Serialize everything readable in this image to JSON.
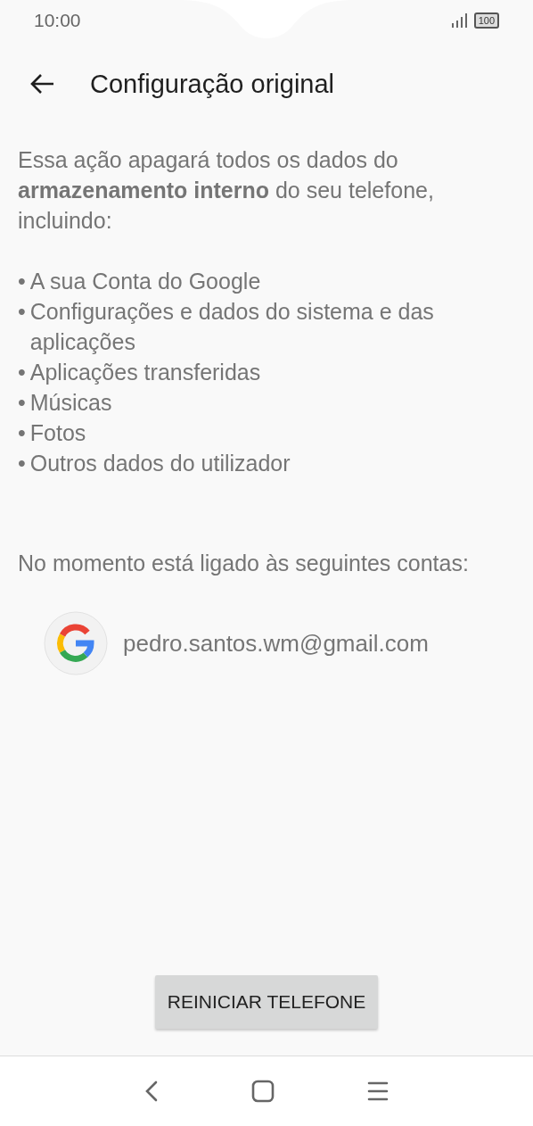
{
  "status_bar": {
    "time": "10:00",
    "battery": "100"
  },
  "header": {
    "title": "Configuração original"
  },
  "intro": "Essa ação apagará todos os dados do **armazenamento interno** do seu telefone, incluindo:",
  "items": [
    {
      "bullet": "•",
      "text": "A sua Conta do Google"
    },
    {
      "bullet": "•",
      "text": "Configurações e dados do sistema e das aplicações"
    },
    {
      "bullet": "•",
      "text": "Aplicações transferidas"
    },
    {
      "bullet": "•",
      "text": "Músicas"
    },
    {
      "bullet": "•",
      "text": "Fotos"
    },
    {
      "bullet": "•",
      "text": "Outros dados do utilizador"
    }
  ],
  "accounts_note": "No momento está ligado às seguintes contas:",
  "accounts": [
    {
      "email": "pedro.santos.wm@gmail.com"
    }
  ],
  "button": "REINICIAR TELEFONE"
}
